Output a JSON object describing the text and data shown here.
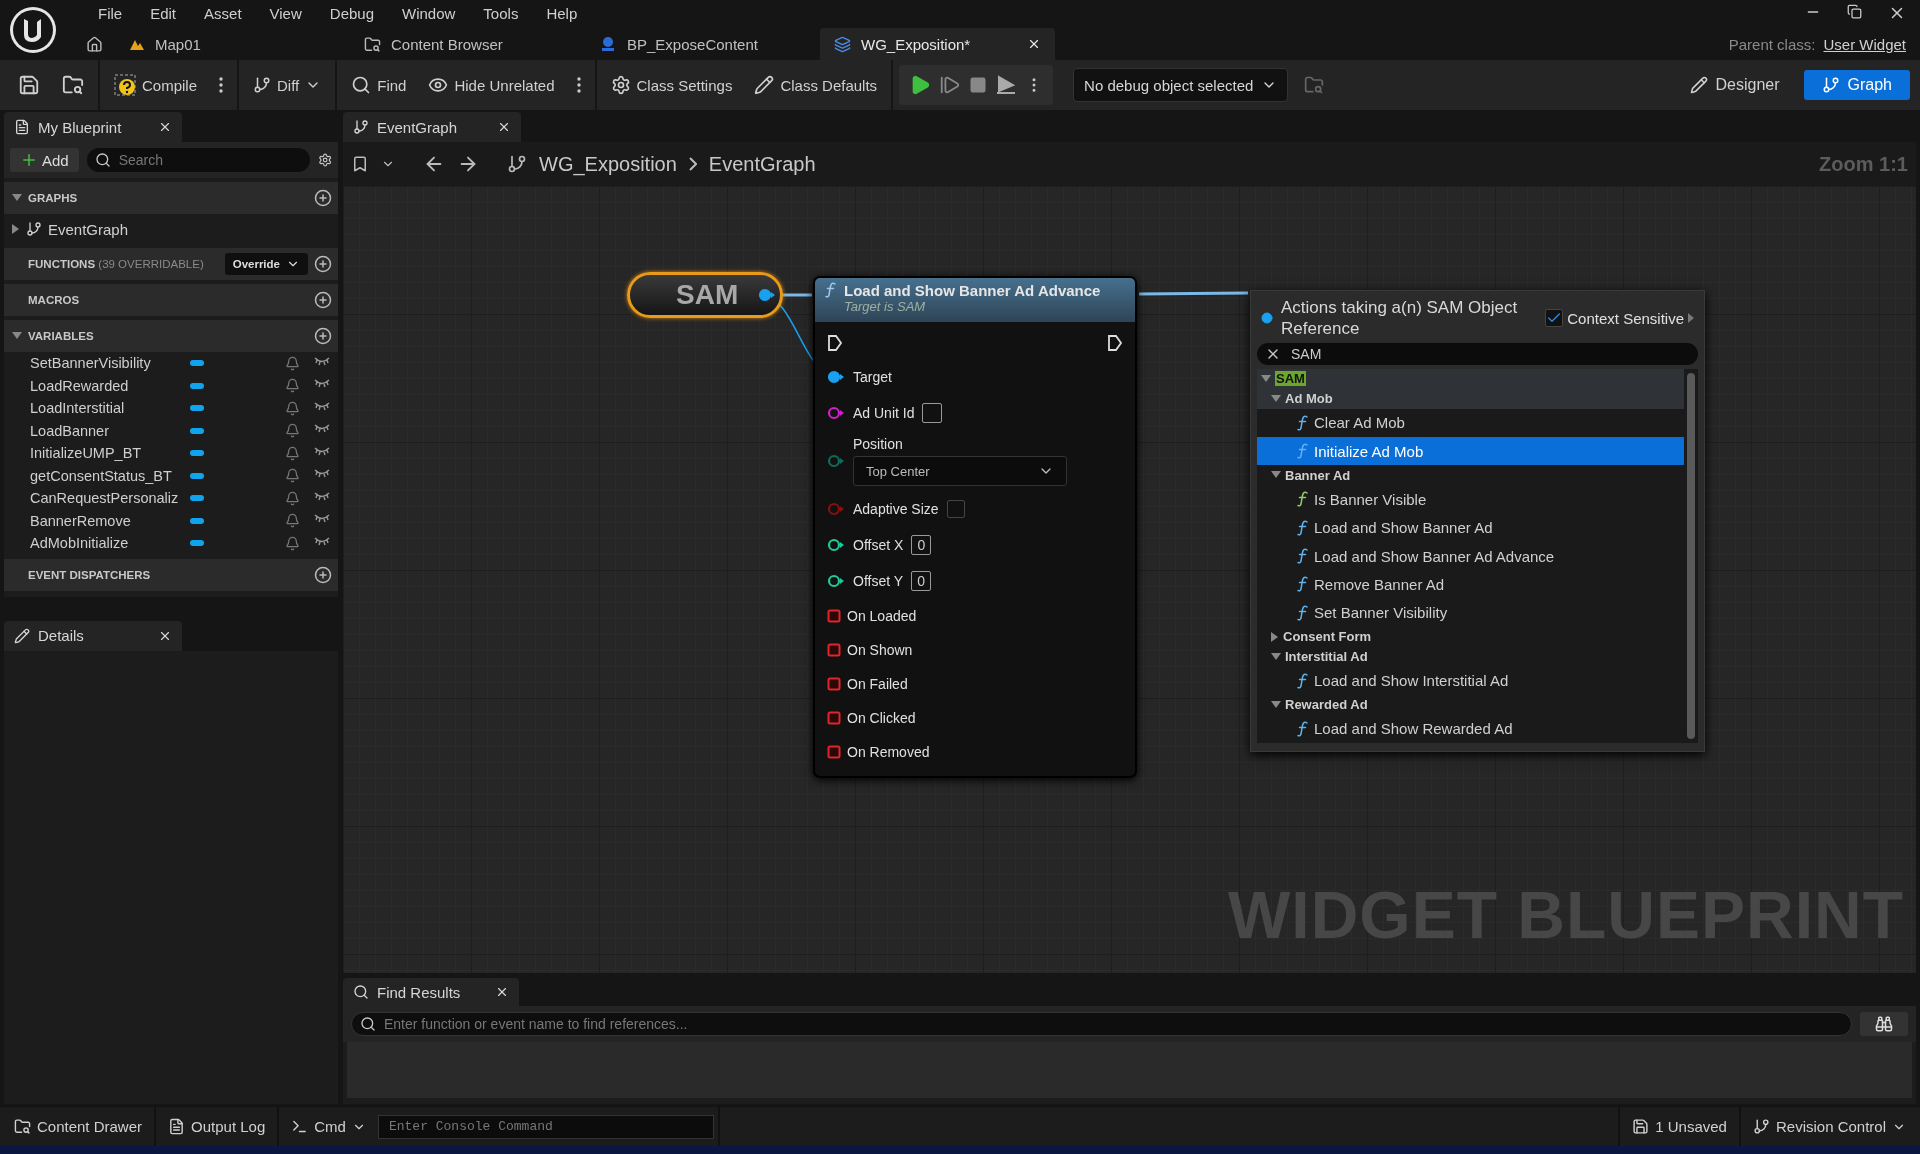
{
  "menu_bar": [
    "File",
    "Edit",
    "Asset",
    "View",
    "Debug",
    "Window",
    "Tools",
    "Help"
  ],
  "document_tabs": [
    {
      "label": "Map01",
      "kind": "level",
      "selected": false
    },
    {
      "label": "Content Browser",
      "kind": "browser",
      "selected": false
    },
    {
      "label": "BP_ExposeContent",
      "kind": "blueprint",
      "selected": false
    },
    {
      "label": "WG_Exposition*",
      "kind": "widget",
      "selected": true
    }
  ],
  "parent_class": {
    "label": "Parent class:",
    "value": "User Widget"
  },
  "toolbar": {
    "compile": "Compile",
    "diff": "Diff",
    "find": "Find",
    "hide_unrelated": "Hide Unrelated",
    "class_settings": "Class Settings",
    "class_defaults": "Class Defaults",
    "debug_object": "No debug object selected"
  },
  "mode_buttons": [
    {
      "label": "Designer",
      "kind": "designer",
      "selected": false
    },
    {
      "label": "Graph",
      "kind": "graph",
      "selected": true
    }
  ],
  "my_blueprint": {
    "tab": "My Blueprint",
    "add": "Add",
    "search_placeholder": "Search",
    "graphs": {
      "title": "GRAPHS",
      "expanded": true,
      "items": [
        "EventGraph"
      ]
    },
    "functions": {
      "title": "FUNCTIONS",
      "note": "(39 OVERRIDABLE)",
      "override": "Override"
    },
    "macros": {
      "title": "MACROS"
    },
    "variables": {
      "title": "VARIABLES",
      "expanded": true,
      "items": [
        "SetBannerVisibility",
        "LoadRewarded",
        "LoadInterstitial",
        "LoadBanner",
        "InitializeUMP_BT",
        "getConsentStatus_BT",
        "CanRequestPersonaliz",
        "BannerRemove",
        "AdMobInitialize"
      ]
    },
    "event_dispatchers": {
      "title": "EVENT DISPATCHERS"
    }
  },
  "details": {
    "tab": "Details"
  },
  "graph_editor": {
    "tab": "EventGraph",
    "breadcrumb": [
      "WG_Exposition",
      "EventGraph"
    ],
    "zoom": "Zoom 1:1",
    "graph_type": "WIDGET BLUEPRINT",
    "variable_node": {
      "label": "SAM"
    },
    "function_node": {
      "title": "Load and Show Banner Ad Advance",
      "subtitle": "Target is SAM",
      "inputs": [
        {
          "kind": "object",
          "label": "Target",
          "color": "#1aa0f0",
          "connected": true
        },
        {
          "kind": "text",
          "label": "Ad Unit Id",
          "color": "#d21ecb",
          "connected": false
        },
        {
          "kind": "enum",
          "label": "Position",
          "value": "Top Center",
          "color": "#0e6b5a",
          "connected": false
        },
        {
          "kind": "bool",
          "label": "Adaptive Size",
          "color": "#8a0f0f",
          "checked": false,
          "connected": false
        },
        {
          "kind": "number",
          "label": "Offset X",
          "value": "0",
          "color": "#1ec99a",
          "connected": false
        },
        {
          "kind": "number",
          "label": "Offset Y",
          "value": "0",
          "color": "#1ec99a",
          "connected": false
        }
      ],
      "outputs": [
        "On Loaded",
        "On Shown",
        "On Failed",
        "On Clicked",
        "On Removed"
      ]
    },
    "context_menu": {
      "title": "Actions taking a(n) SAM Object Reference",
      "context_sensitive": {
        "label": "Context Sensitive",
        "checked": true
      },
      "search": "SAM",
      "root": {
        "label": "SAM",
        "highlighted": true,
        "expanded": true,
        "children": [
          {
            "kind": "category",
            "label": "Ad Mob",
            "expanded": true,
            "children": [
              {
                "kind": "function",
                "label": "Clear Ad Mob",
                "pure": false,
                "selected": false
              },
              {
                "kind": "function",
                "label": "Initialize Ad Mob",
                "pure": false,
                "selected": true
              }
            ]
          },
          {
            "kind": "category",
            "label": "Banner Ad",
            "expanded": true,
            "children": [
              {
                "kind": "function",
                "label": "Is Banner Visible",
                "pure": true,
                "selected": false
              },
              {
                "kind": "function",
                "label": "Load and Show Banner Ad",
                "pure": false,
                "selected": false
              },
              {
                "kind": "function",
                "label": "Load and Show Banner Ad Advance",
                "pure": false,
                "selected": false
              },
              {
                "kind": "function",
                "label": "Remove Banner Ad",
                "pure": false,
                "selected": false
              },
              {
                "kind": "function",
                "label": "Set Banner Visibility",
                "pure": false,
                "selected": false
              }
            ]
          },
          {
            "kind": "category",
            "label": "Consent Form",
            "expanded": false
          },
          {
            "kind": "category",
            "label": "Interstitial Ad",
            "expanded": true,
            "children": [
              {
                "kind": "function",
                "label": "Load and Show Interstitial Ad",
                "pure": false,
                "selected": false
              }
            ]
          },
          {
            "kind": "category",
            "label": "Rewarded Ad",
            "expanded": true,
            "children": [
              {
                "kind": "function",
                "label": "Load and Show Rewarded Ad",
                "pure": false,
                "selected": false
              }
            ]
          }
        ]
      }
    }
  },
  "find_results": {
    "tab": "Find Results",
    "placeholder": "Enter function or event name to find references..."
  },
  "status_bar": {
    "content_drawer": "Content Drawer",
    "output_log": "Output Log",
    "cmd": "Cmd",
    "console_placeholder": "Enter Console Command",
    "unsaved": "1 Unsaved",
    "revision_control": "Revision Control"
  }
}
